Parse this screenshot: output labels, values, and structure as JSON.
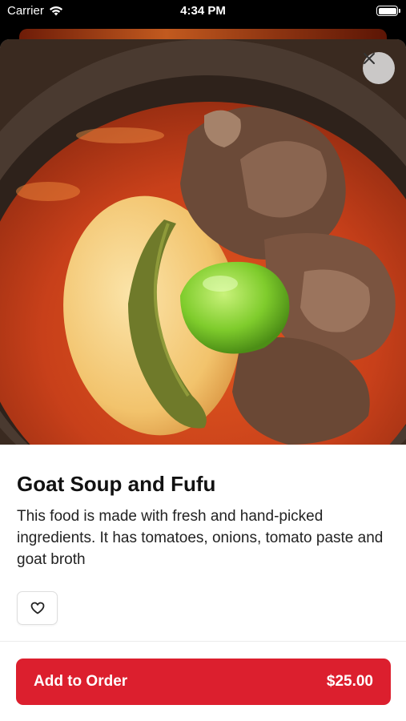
{
  "status_bar": {
    "carrier": "Carrier",
    "time": "4:34 PM",
    "icons": [
      "wifi-icon",
      "battery-icon"
    ]
  },
  "product": {
    "image": "photo of goat soup with fufu, pepper and okra in a clay bowl",
    "title": "Goat Soup and Fufu",
    "description": "This food is made with fresh and hand-picked ingredients. It has tomatoes, onions, tomato paste and goat broth"
  },
  "actions": {
    "close_icon": "close-icon",
    "favorite_icon": "heart-icon",
    "add_to_order_label": "Add to Order",
    "price": "$25.00"
  },
  "colors": {
    "accent": "#dc1f2e",
    "background": "#ffffff",
    "text": "#111111"
  }
}
